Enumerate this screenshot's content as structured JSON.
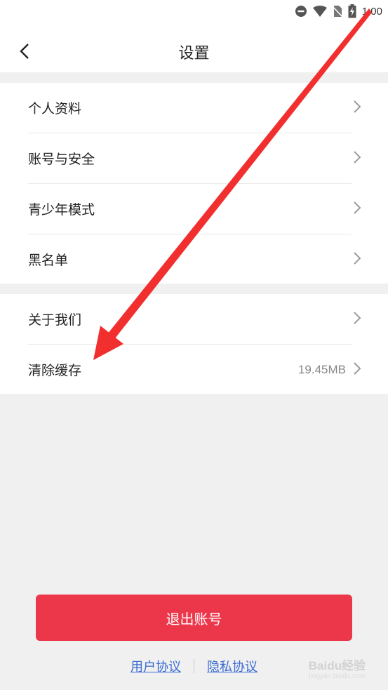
{
  "status_bar": {
    "time": "1:00"
  },
  "header": {
    "title": "设置"
  },
  "group1": [
    {
      "label": "个人资料"
    },
    {
      "label": "账号与安全"
    },
    {
      "label": "青少年模式"
    },
    {
      "label": "黑名单"
    }
  ],
  "group2": [
    {
      "label": "关于我们",
      "value": ""
    },
    {
      "label": "清除缓存",
      "value": "19.45MB"
    }
  ],
  "logout": {
    "label": "退出账号"
  },
  "footer": {
    "user_agreement": "用户协议",
    "privacy_agreement": "隐私协议"
  },
  "watermark": {
    "brand": "Baidu经验",
    "url": "jingyan.baidu.com"
  },
  "colors": {
    "accent": "#ec374b",
    "link": "#3a6bd1",
    "annotation_arrow": "#f22f2f"
  }
}
